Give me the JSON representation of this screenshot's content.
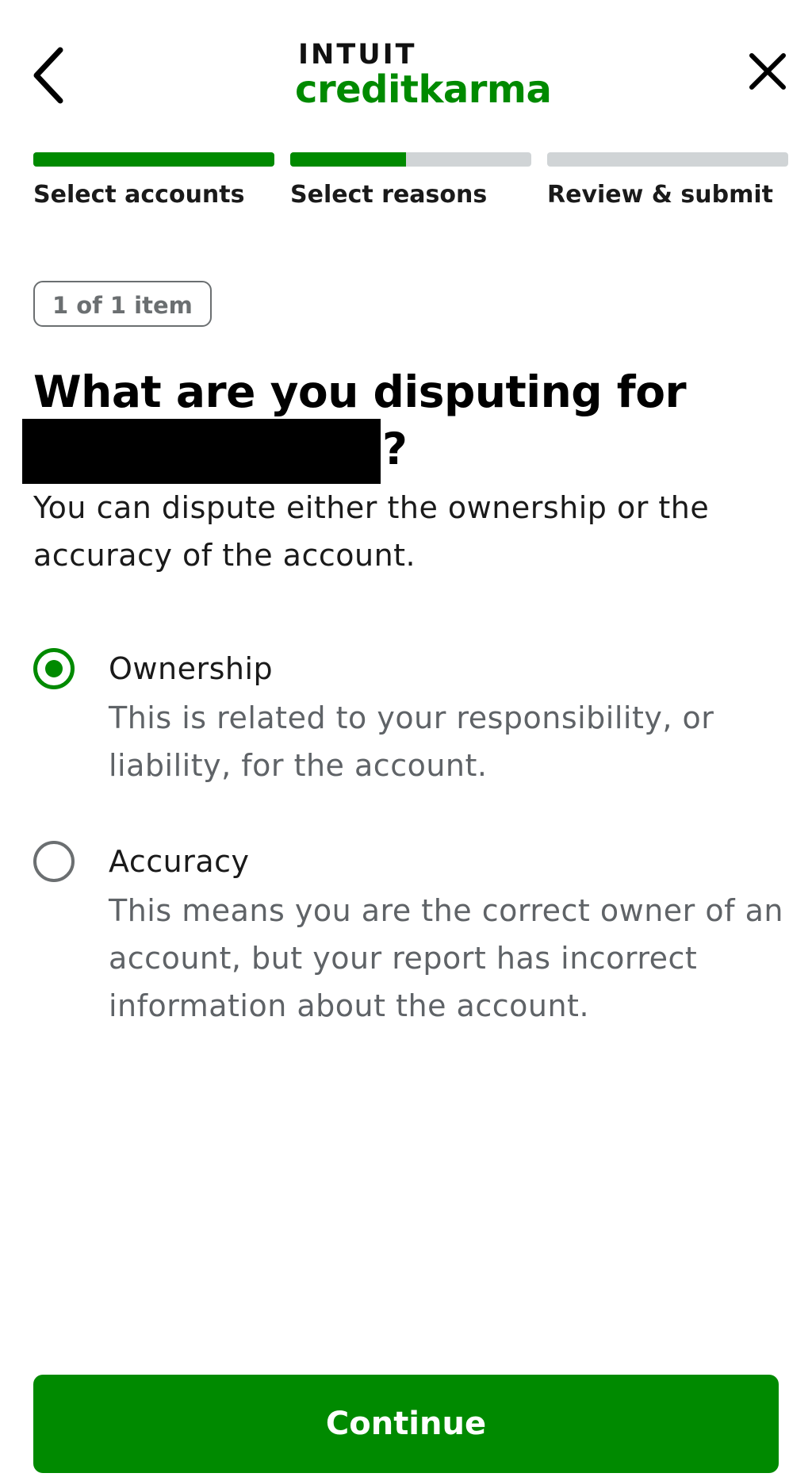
{
  "header": {
    "back_icon": "chevron-left-icon",
    "close_icon": "close-icon",
    "logo": {
      "top_text": "INTUIT",
      "bottom_text": "creditkarma",
      "brand_color": "#008a00"
    }
  },
  "stepper": {
    "steps": [
      {
        "label": "Select accounts",
        "progress": 1.0
      },
      {
        "label": "Select reasons",
        "progress": 0.48
      },
      {
        "label": "Review & submit",
        "progress": 0.0
      }
    ],
    "active_color": "#008a00",
    "inactive_color": "#d0d4d6"
  },
  "item_counter": "1 of 1 item",
  "question": {
    "line1": "What are you disputing for",
    "suffix": "?"
  },
  "subtitle": "You can dispute either the ownership or the accuracy of the account.",
  "options": [
    {
      "title": "Ownership",
      "description": "This is related to your responsibility, or liability, for the account.",
      "selected": true
    },
    {
      "title": "Accuracy",
      "description": "This means you are the correct owner of an account, but your report has incorrect information about the account.",
      "selected": false
    }
  ],
  "continue_label": "Continue",
  "colors": {
    "accent": "#008a00",
    "muted_text": "#5f6367",
    "badge_border": "#6b6f71"
  }
}
